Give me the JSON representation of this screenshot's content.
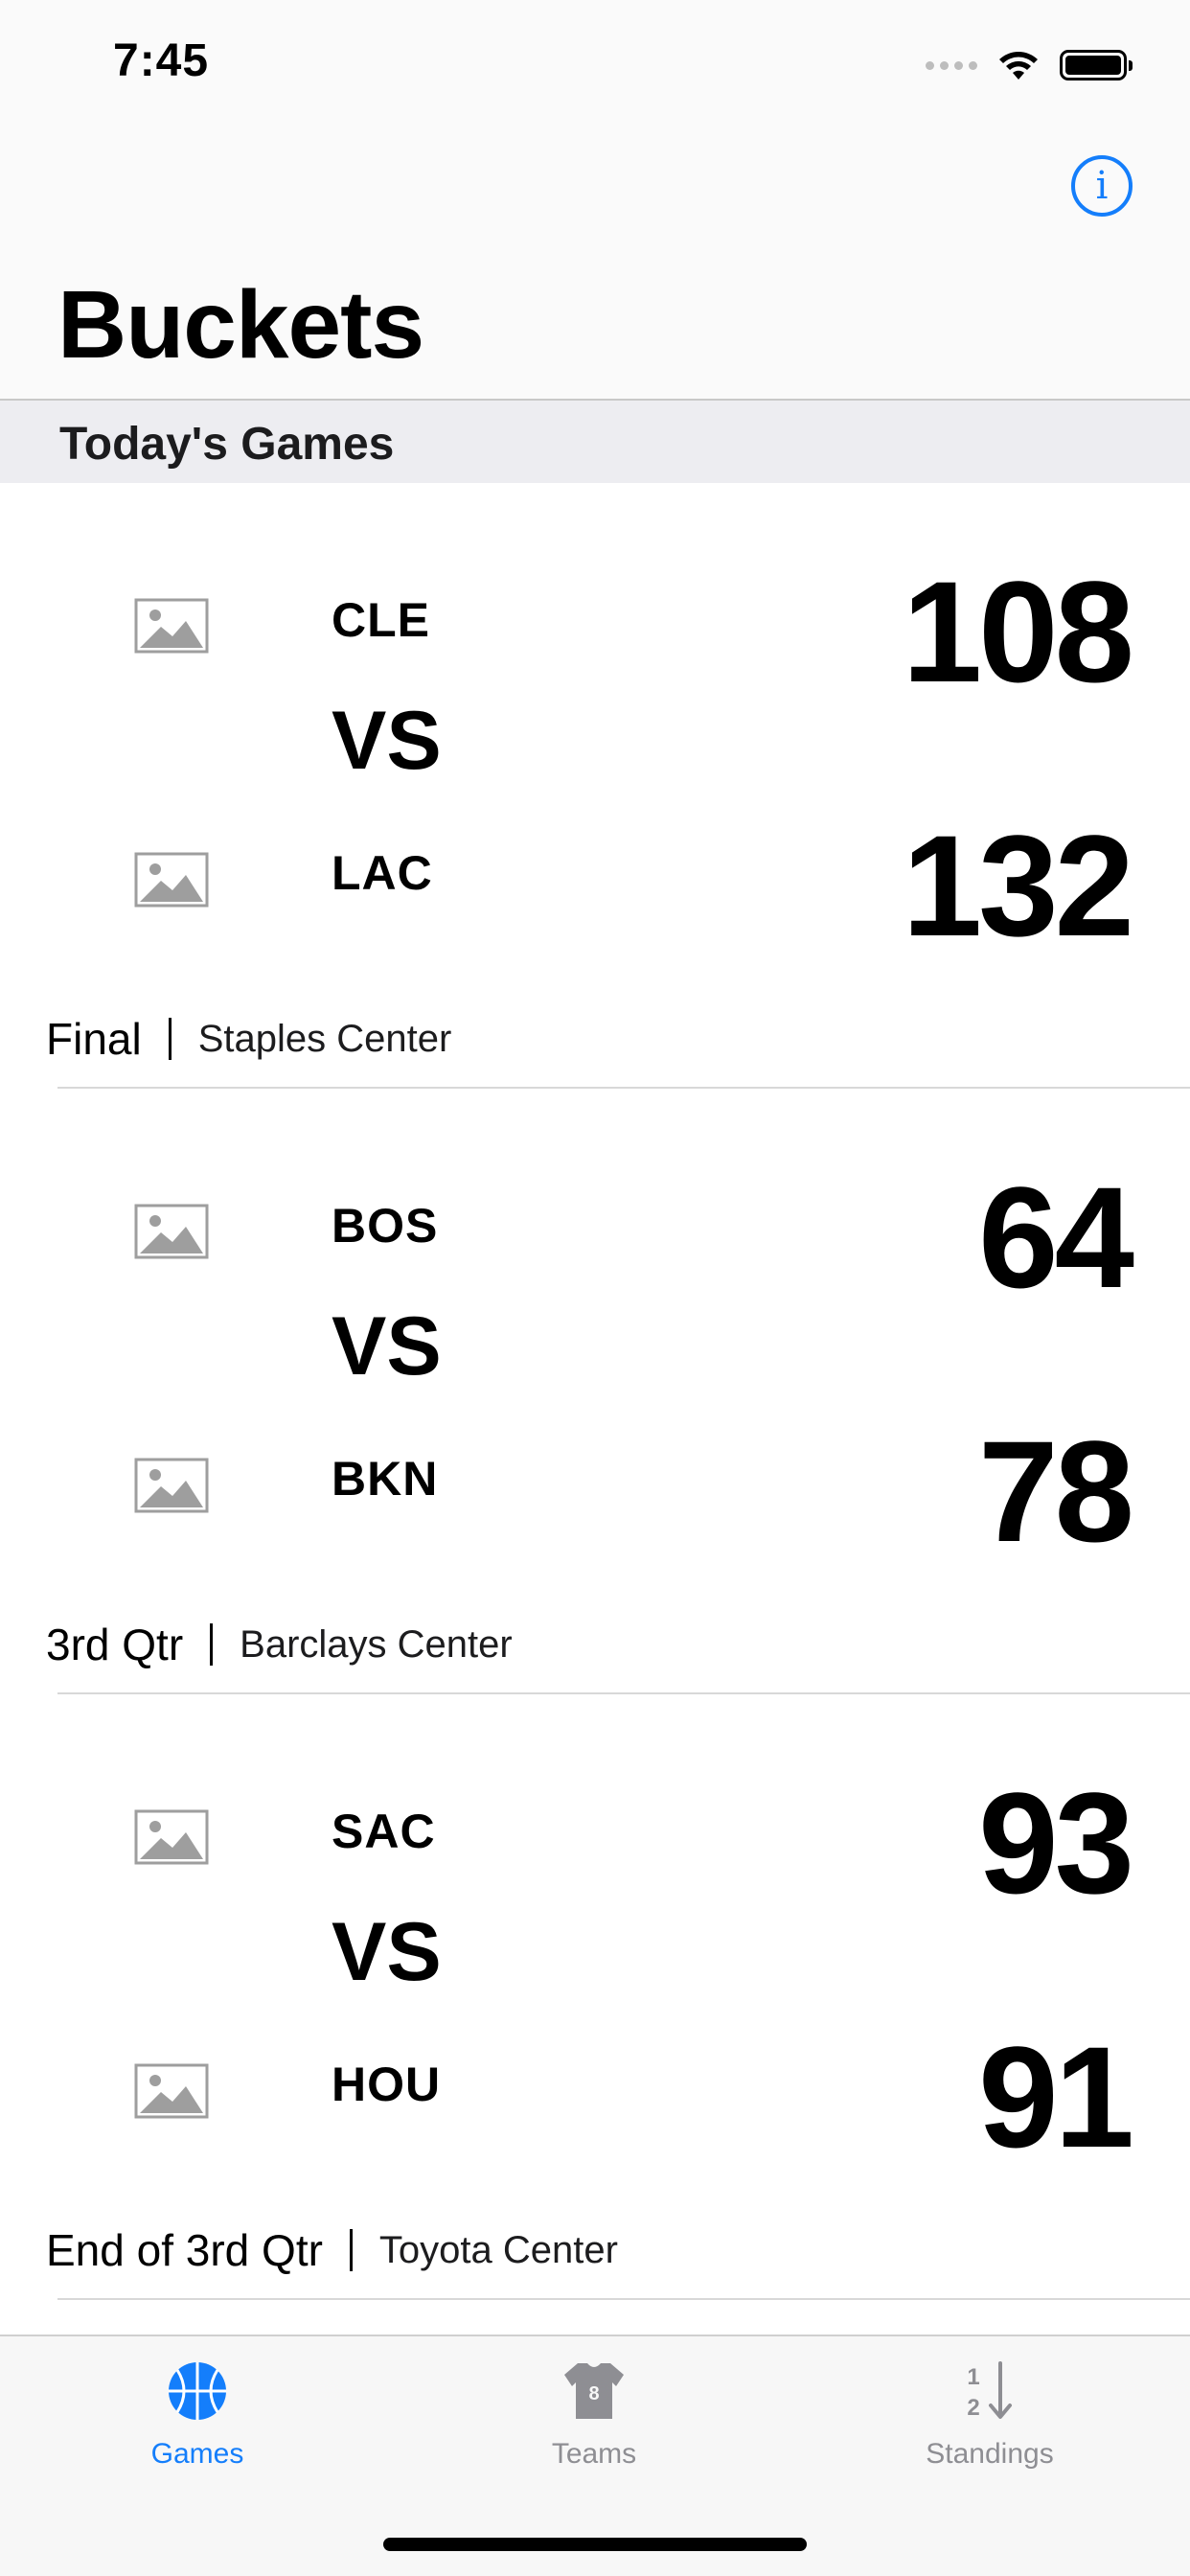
{
  "status_bar": {
    "time": "7:45"
  },
  "header": {
    "title": "Buckets",
    "info_icon": "info-circle-icon"
  },
  "section": {
    "title": "Today's Games"
  },
  "games": [
    {
      "home": {
        "abbr": "CLE",
        "score": "108"
      },
      "vs": "VS",
      "away": {
        "abbr": "LAC",
        "score": "132"
      },
      "status": "Final",
      "venue": "Staples Center"
    },
    {
      "home": {
        "abbr": "BOS",
        "score": "64"
      },
      "vs": "VS",
      "away": {
        "abbr": "BKN",
        "score": "78"
      },
      "status": "3rd Qtr",
      "venue": "Barclays Center"
    },
    {
      "home": {
        "abbr": "SAC",
        "score": "93"
      },
      "vs": "VS",
      "away": {
        "abbr": "HOU",
        "score": "91"
      },
      "status": "End of 3rd Qtr",
      "venue": "Toyota Center"
    }
  ],
  "tabs": [
    {
      "label": "Games",
      "icon": "basketball-icon",
      "selected": true
    },
    {
      "label": "Teams",
      "icon": "jersey-icon",
      "selected": false
    },
    {
      "label": "Standings",
      "icon": "sort-icon",
      "selected": false
    }
  ],
  "colors": {
    "accent": "#147efb",
    "inactive": "#8e8e93",
    "section_bg": "#ededf1"
  }
}
